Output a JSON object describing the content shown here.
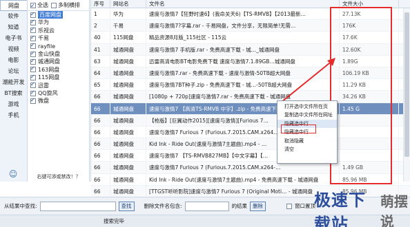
{
  "categories": {
    "items": [
      "网盘",
      "软件",
      "知道",
      "电子书",
      "视频",
      "电影",
      "论坛",
      "潮能开发",
      "BT搜索",
      "游戏",
      "手机"
    ],
    "selected_index": 0
  },
  "sources": {
    "select_all_label": "全选",
    "multi_select_label": "多制横排",
    "items": [
      {
        "label": "百度网盘",
        "checked": true,
        "highlighted": true
      },
      {
        "label": "华为",
        "checked": true
      },
      {
        "label": "乐视云",
        "checked": true
      },
      {
        "label": "千易",
        "checked": true
      },
      {
        "label": "rayfile",
        "checked": true
      },
      {
        "label": "金山快盘",
        "checked": true
      },
      {
        "label": "城通网盘",
        "checked": true
      },
      {
        "label": "163网盘",
        "checked": true
      },
      {
        "label": "115网盘",
        "checked": true
      },
      {
        "label": "迅雷",
        "checked": true
      },
      {
        "label": "QQ旋风",
        "checked": true
      },
      {
        "label": "微盘",
        "checked": true
      }
    ],
    "footer_text": "右键可添或禁改！？"
  },
  "table": {
    "headers": {
      "num": "序号",
      "site": "网站名",
      "name": "文件名",
      "size": "文件大小"
    },
    "rows": [
      {
        "num": "1",
        "site": "华为",
        "name": "速度与激情7【狂野时速6】(我命关天6)【TS-RMVB】【2013最新…",
        "size": "27.13K"
      },
      {
        "num": "2",
        "site": "千易",
        "name": "速度与激情7?字幕.rar - 千易网盘，文件分享，无限简单!无需…",
        "size": "176K"
      },
      {
        "num": "40",
        "site": "115网盘",
        "name": "精品资源8月版_115社区 - 115云",
        "size": "17.6K"
      },
      {
        "num": "41",
        "site": "城通网盘",
        "name": "速度与激情7 手机版.rar - 免费高速下载 - 城…_城通网盘",
        "size": "12.60K"
      },
      {
        "num": "63",
        "site": "城通网盘",
        "name": "迅雷高清电影BT电影免费下载 速度与激情7.1.89GB…城通网盘",
        "size": "1.89G"
      },
      {
        "num": "64",
        "site": "城通网盘",
        "name": "速度与激情7.rar - 免费高速下载 - 速度与激情-50TB超大网盘",
        "size": "106.19 KB"
      },
      {
        "num": "65",
        "site": "城通网盘",
        "name": "速度与激情7BT种子.zip - 免费高速下载 - 城…-50TB超大网盘",
        "size": "11.29 KB"
      },
      {
        "num": "66",
        "site": "城通网盘",
        "name": "[1080p + 720p]速度与激情7.rar - 免费高速下载 - 城通网盘",
        "size": "34.26 KB"
      },
      {
        "num": "66",
        "site": "城通网盘",
        "name": "速度与激情7 【高清TS-RMVB 中字】.zip - 免费高速下载 - 城…",
        "size": "1.45 G"
      },
      {
        "num": "66",
        "site": "城通网盘",
        "name": "【枪版】[巨翼动作2015][速度与激情][Furious 7…",
        "size": ""
      },
      {
        "num": "66",
        "site": "城通网盘",
        "name": "速度与激情7 Furious 7 (Furious.7.2015.CAM.x264…",
        "size": ""
      },
      {
        "num": "66",
        "site": "城通网盘",
        "name": "Kid Ink - Ride Out(速度与激情7主题曲).mp4 - …",
        "size": ""
      },
      {
        "num": "66",
        "site": "城通网盘",
        "name": "速度与激情7 【TS-RMVB827MB】【中文字幕】【…",
        "size": ""
      },
      {
        "num": "66",
        "site": "城通网盘",
        "name": "速度与激情7 Furious 7 (Furious.7.2015.CAM.x264-…",
        "size": "1.49 GB"
      },
      {
        "num": "66",
        "site": "城通网盘",
        "name": "Kid Ink - Ride Out(速度与激情7主题曲).mp4 - 免费高速下载 - 城通网盘",
        "size": "85.96 MB"
      },
      {
        "num": "66",
        "site": "城通网盘",
        "name": "[TTGST听听影院]速度与激情7 Furious 7 (Original Moti… - 城通网盘",
        "size": "85.96 MB"
      }
    ],
    "selected_row_index": 8
  },
  "context_menu": {
    "items": [
      "打开选中文件所在页",
      "复制选中文件所在网址",
      "隐藏选中行",
      "隐藏选中行",
      "取消隐藏",
      "清空"
    ],
    "highlighted_index": 2
  },
  "search_bar": {
    "find_label": "从结果中查找:",
    "find_button": "查找",
    "delete_label": "删除文件名包含:",
    "result_label": "的结果",
    "delete_button": "删除",
    "top_checkbox_label": "窗口置顶"
  },
  "status_text": "搜索完毕",
  "watermark": {
    "text1": "极速下载站",
    "text2": "萌摆说"
  },
  "colors": {
    "selected_row": "#6f8fbe",
    "annotation_red": "#e52b2b",
    "accent_blue": "#3d7bd6"
  }
}
